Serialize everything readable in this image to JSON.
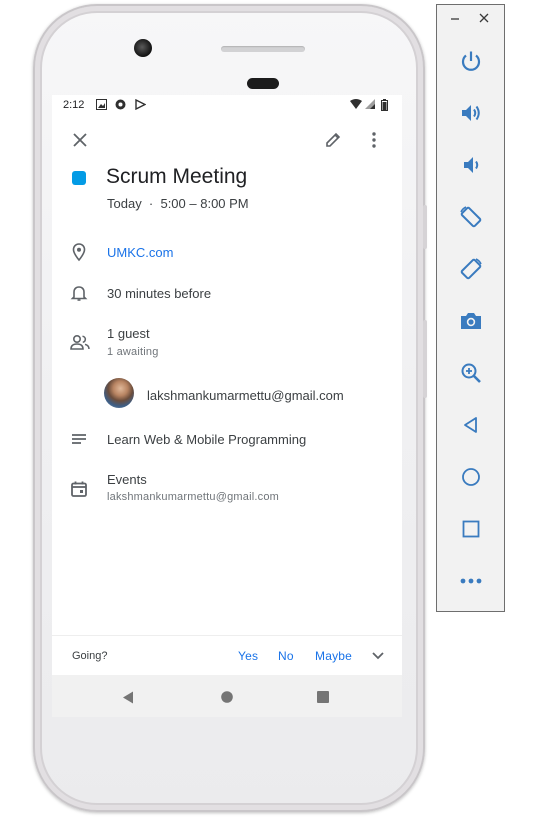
{
  "status_bar": {
    "time": "2:12",
    "icons": [
      "image-icon",
      "settings-sync-icon",
      "play-protect-icon",
      "wifi-icon",
      "signal-icon",
      "battery-icon"
    ]
  },
  "top_bar": {
    "icons": [
      "close-icon",
      "edit-pencil-icon",
      "more-vert-icon"
    ]
  },
  "event": {
    "color": "#039be5",
    "title": "Scrum Meeting",
    "when": "Today  ·  5:00 – 8:00 PM",
    "location": "UMKC.com",
    "notification": "30 minutes before",
    "guests_summary": "1 guest",
    "guests_status": "1 awaiting",
    "guest_email": "lakshmankumarmettu@gmail.com",
    "description": "Learn Web & Mobile Programming",
    "calendar_name": "Events",
    "calendar_owner": "lakshmankumarmettu@gmail.com"
  },
  "rsvp": {
    "prompt": "Going?",
    "options": [
      "Yes",
      "No",
      "Maybe"
    ]
  },
  "nav": {
    "icons": [
      "back-triangle-icon",
      "home-circle-icon",
      "recents-square-icon"
    ]
  },
  "emulator_toolbar": {
    "window_controls": [
      "minimize",
      "close"
    ],
    "buttons": [
      "power",
      "volume-up",
      "volume-down",
      "rotate-left",
      "rotate-right",
      "screenshot",
      "zoom",
      "back",
      "home",
      "overview",
      "more"
    ]
  },
  "colors": {
    "accent": "#1a73e8",
    "toolbar_icon": "#3a7bbf"
  }
}
